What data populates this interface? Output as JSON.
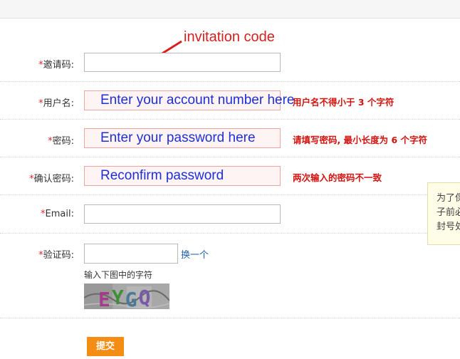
{
  "annotation": {
    "text": "invitation code"
  },
  "required_mark": "*",
  "fields": {
    "invite": {
      "label": "邀请码:"
    },
    "username": {
      "label": "用户名:",
      "overlay": "Enter your account number here",
      "error": "用户名不得小于 3 个字符"
    },
    "password": {
      "label": "密码:",
      "overlay": "Enter your password here",
      "error": "请填写密码, 最小长度为 6 个字符"
    },
    "confirm": {
      "label": "确认密码:",
      "overlay": "Reconfirm password",
      "error": "两次输入的密码不一致"
    },
    "email": {
      "label": "Email:"
    },
    "captcha": {
      "label": "验证码:",
      "refresh": "换一个",
      "hint": "输入下图中的字符",
      "image_text": "EYGQ"
    }
  },
  "tooltip": {
    "lines": [
      "为了保",
      "子前必",
      "封号处"
    ]
  },
  "submit": {
    "label": "提交"
  },
  "colors": {
    "accent": "#f48d13",
    "error": "#d4130f",
    "required": "#e5262c",
    "link": "#1f5fa8",
    "overlay": "#1d2fd6"
  }
}
